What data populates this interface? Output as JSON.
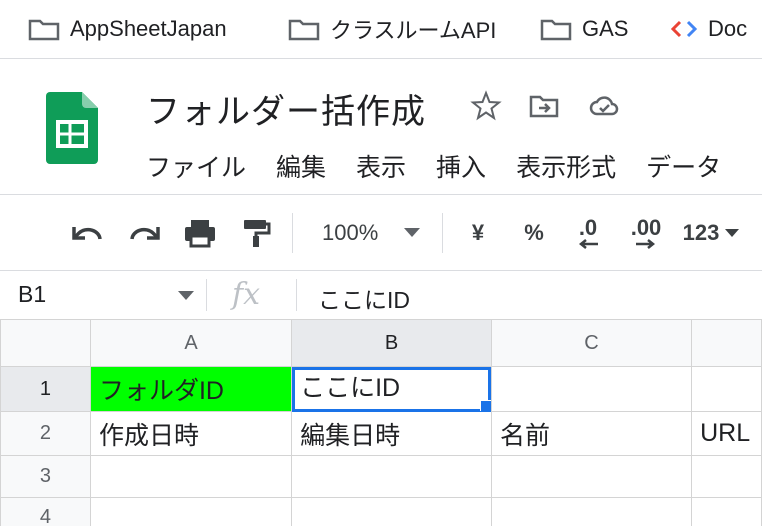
{
  "bookmarks": [
    {
      "label": "AppSheetJapan",
      "icon": "folder-icon"
    },
    {
      "label": "クラスルームAPI",
      "icon": "folder-icon"
    },
    {
      "label": "GAS",
      "icon": "folder-icon"
    },
    {
      "label": "Doc",
      "icon": "code-icon"
    }
  ],
  "header": {
    "title": "フォルダー括作成",
    "menu": [
      "ファイル",
      "編集",
      "表示",
      "挿入",
      "表示形式",
      "データ"
    ]
  },
  "toolbar": {
    "zoom": "100%",
    "currency": "¥",
    "percent": "%",
    "dec_decrease": ".0",
    "dec_increase": ".00",
    "more_formats": "123"
  },
  "formula_bar": {
    "cell_ref": "B1",
    "fx": "fx",
    "content": "ここにID"
  },
  "grid": {
    "columns": [
      "A",
      "B",
      "C"
    ],
    "rows": [
      "1",
      "2",
      "3",
      "4"
    ],
    "cells": [
      [
        "フォルダID",
        "ここにID",
        "",
        ""
      ],
      [
        "作成日時",
        "編集日時",
        "名前",
        "URL"
      ],
      [
        "",
        "",
        "",
        ""
      ],
      [
        "",
        "",
        "",
        ""
      ]
    ]
  },
  "colors": {
    "sheets_green": "#0f9d58",
    "fill_green": "#00ff00",
    "selection_blue": "#1a73e8"
  }
}
